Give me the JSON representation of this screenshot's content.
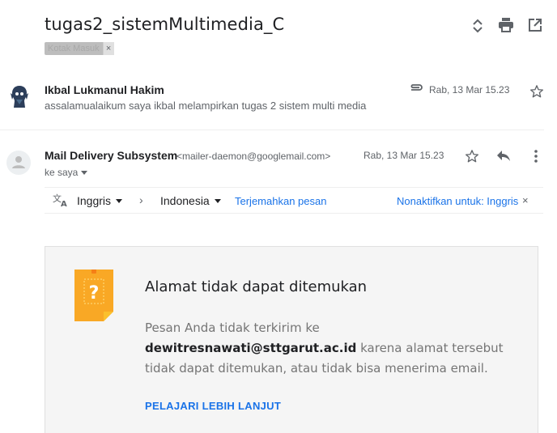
{
  "thread": {
    "subject": "tugas2_sistemMultimedia_C",
    "label": "Kotak Masuk",
    "label_remove": "×"
  },
  "header_actions": [
    {
      "name": "expand-collapse-icon"
    },
    {
      "name": "print-icon"
    },
    {
      "name": "open-new-window-icon"
    }
  ],
  "message1": {
    "sender": "Ikbal Lukmanul Hakim",
    "snippet": "assalamualaikum saya ikbal melampirkan tugas 2 sistem multi media",
    "date": "Rab, 13 Mar 15.23",
    "has_attachment": true
  },
  "message2": {
    "sender": "Mail Delivery Subsystem",
    "email": "<mailer-daemon@googlemail.com>",
    "recipient": "ke saya",
    "date": "Rab, 13 Mar 15.23"
  },
  "translate_bar": {
    "from_lang": "Inggris",
    "to_lang": "Indonesia",
    "translate_link": "Terjemahkan pesan",
    "disable_link": "Nonaktifkan untuk: Inggris",
    "close": "×"
  },
  "bounce": {
    "title": "Alamat tidak dapat ditemukan",
    "body_prefix": "Pesan Anda tidak terkirim ke ",
    "address": "dewitresnawati@sttgarut.ac.id",
    "body_suffix": " karena alamat tersebut tidak dapat ditemukan, atau tidak bisa menerima email.",
    "learn_more": "PELAJARI LEBIH LANJUT"
  },
  "colors": {
    "link": "#1a73e8",
    "note_icon": "#f9a825"
  }
}
